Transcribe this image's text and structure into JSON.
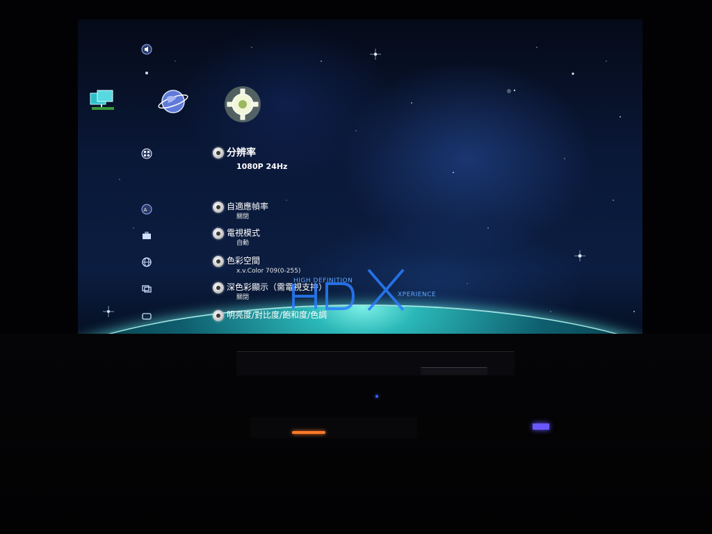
{
  "menu": {
    "items": [
      {
        "label": "分辨率",
        "value": "1080P 24Hz",
        "selected": true
      },
      {
        "label": "自適應幀率",
        "value": "關閉"
      },
      {
        "label": "電視模式",
        "value": "自動"
      },
      {
        "label": "色彩空間",
        "value": "x.v.Color 709(0-255)"
      },
      {
        "label": "深色彩顯示（需電視支持）",
        "value": "關閉"
      },
      {
        "label": "明亮度/對比度/飽和度/色調",
        "value": ""
      }
    ]
  },
  "side_icons": [
    "speaker-icon",
    "dot-icon",
    "film-reel-icon",
    "subtitle-icon",
    "toolbox-icon",
    "globe-icon",
    "window-icon",
    "message-icon"
  ],
  "top_icons": [
    "network-computer-icon",
    "internet-globe-icon",
    "settings-gear-icon"
  ],
  "logo": {
    "letters": "HDX",
    "tagline_left": "HIGH DEFINITION",
    "tagline_right": "XPERIENCE"
  },
  "colors": {
    "accent_cyan": "#2ecfd8",
    "logo_blue": "#2a7dff",
    "text_white": "#ffffff",
    "front_display": "#6a58ff"
  }
}
